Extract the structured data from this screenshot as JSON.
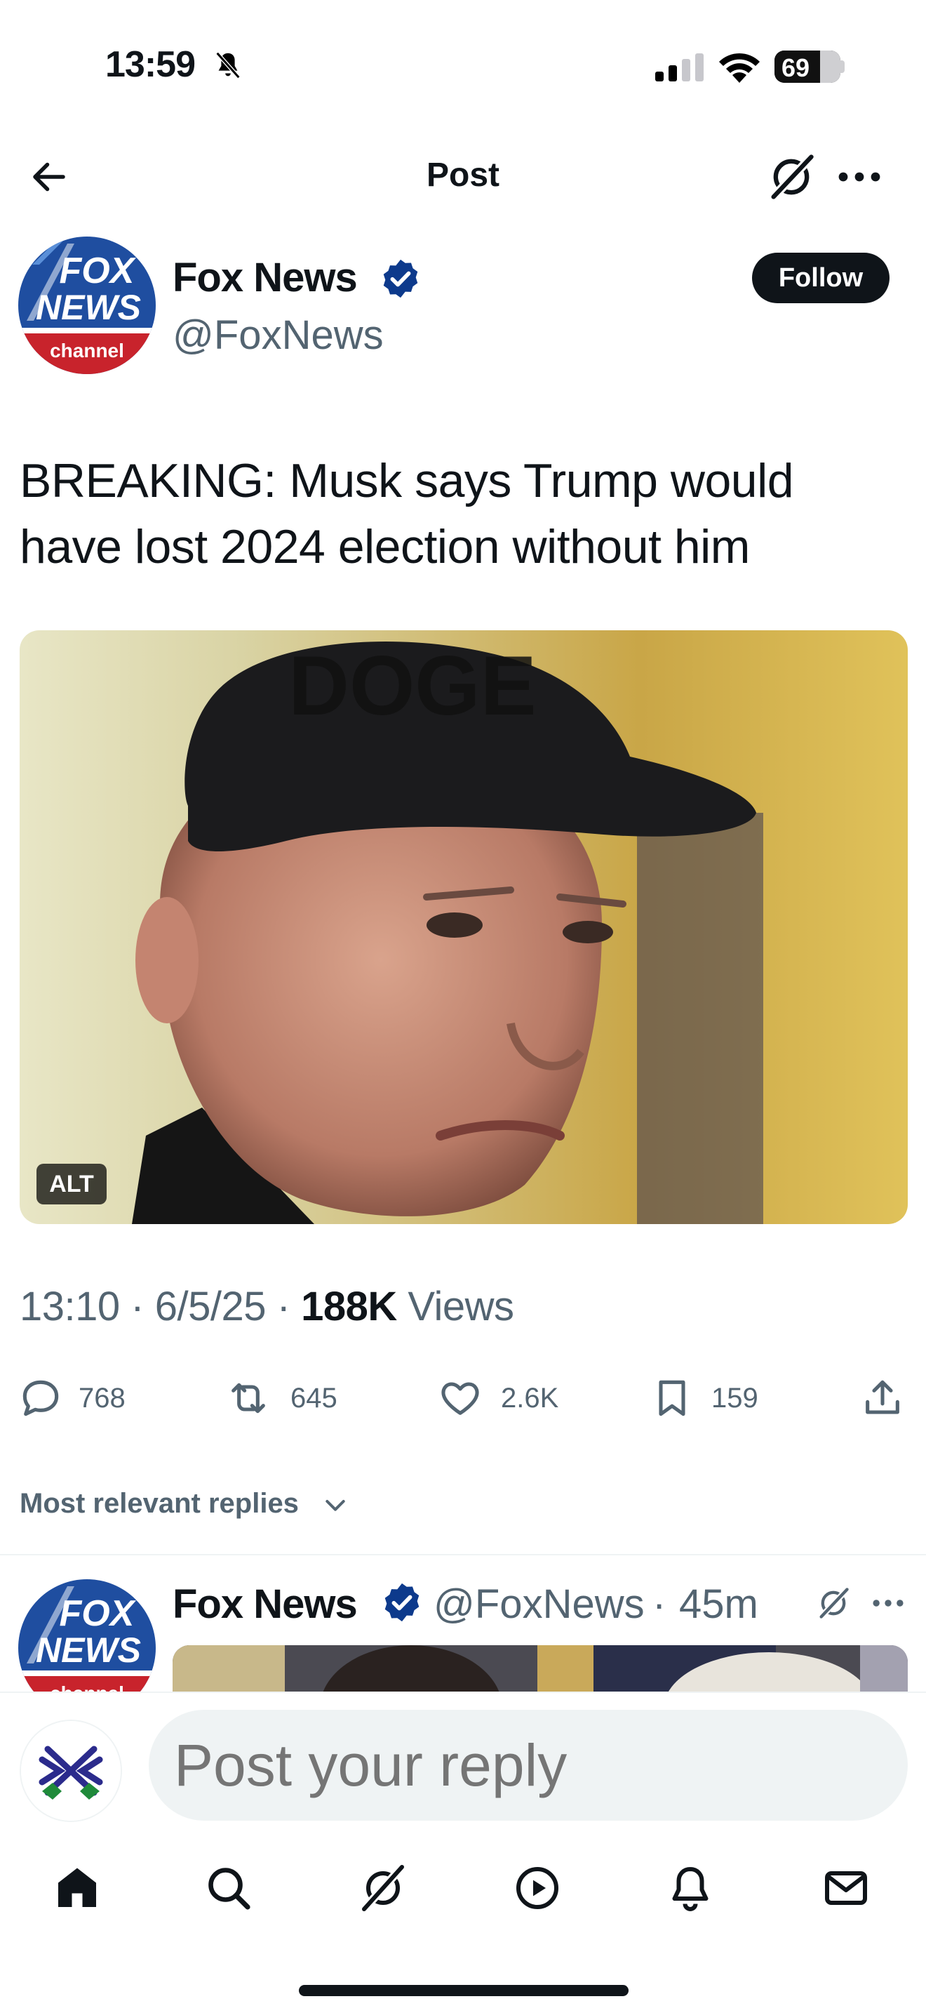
{
  "status_bar": {
    "time": "13:59",
    "battery": "69",
    "battery_level": 0.69
  },
  "header": {
    "title": "Post"
  },
  "post": {
    "author_name": "Fox News",
    "author_handle": "@FoxNews",
    "follow_label": "Follow",
    "text": "BREAKING: Musk says Trump would have lost 2024 election without him",
    "image_alt_badge": "ALT",
    "cap_text": "DOGE",
    "meta": {
      "time": "13:10",
      "date": "6/5/25",
      "views_count": "188K",
      "views_label": "Views",
      "separator": "·"
    },
    "actions": {
      "replies": "768",
      "reposts": "645",
      "likes": "2.6K",
      "bookmarks": "159"
    }
  },
  "logo": {
    "line1": "FOX",
    "line2": "NEWS",
    "line3": "channel"
  },
  "replies": {
    "sort_label": "Most relevant replies"
  },
  "reply_preview": {
    "author_name": "Fox News",
    "author_handle": "@FoxNews",
    "separator": "·",
    "time": "45m"
  },
  "composer": {
    "placeholder": "Post your reply"
  },
  "colors": {
    "verified_blue": "#0d3a8c",
    "follow_bg": "#0f1419",
    "secondary_text": "#536471",
    "fox_blue": "#1f4ea0",
    "fox_red": "#c8232c"
  },
  "icons": {
    "nav": [
      "home-icon",
      "search-icon",
      "grok-icon",
      "video-icon",
      "notifications-icon",
      "messages-icon"
    ]
  }
}
